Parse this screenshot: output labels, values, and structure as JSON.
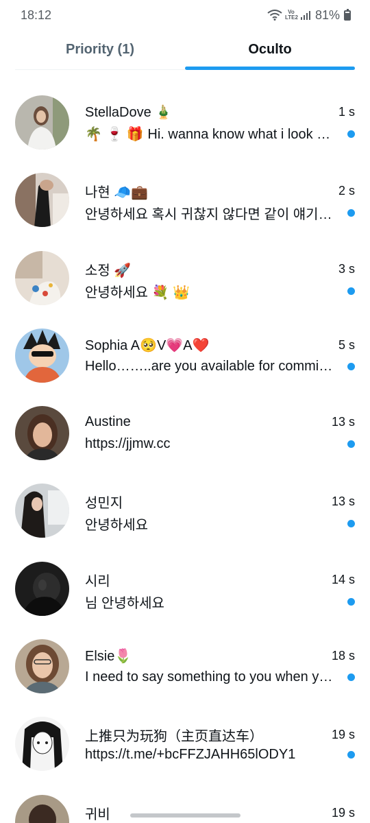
{
  "status_bar": {
    "time": "18:12",
    "network_tag": "Vo LTE2",
    "battery": "81%",
    "battery_level": 0.81
  },
  "tabs": [
    {
      "label": "Priority (1)",
      "active": false
    },
    {
      "label": "Oculto",
      "active": true
    }
  ],
  "accent_color": "#1d9bf0",
  "conversations": [
    {
      "name": "StellaDove 🎍",
      "time": "1 s",
      "preview": "🌴 🍷 🎁 Hi. wanna know what i look like?",
      "unread": true
    },
    {
      "name": "나현 🧢💼",
      "time": "2 s",
      "preview": "안녕하세요 혹시 귀찮지 않다면 같이 얘기해요",
      "unread": true
    },
    {
      "name": "소정 🚀",
      "time": "3 s",
      "preview": "안녕하세요 💐 👑",
      "unread": true
    },
    {
      "name": "Sophia A🥺V💗A❤️",
      "time": "5 s",
      "preview": "Hello……..are you available for commission?",
      "unread": true
    },
    {
      "name": "Austine",
      "time": "13 s",
      "preview": "https://jjmw.cc",
      "unread": true
    },
    {
      "name": "성민지",
      "time": "13 s",
      "preview": "안녕하세요",
      "unread": true
    },
    {
      "name": "시리",
      "time": "14 s",
      "preview": "님 안녕하세요",
      "unread": true
    },
    {
      "name": "Elsie🌷",
      "time": "18 s",
      "preview": "I need to say something to you when you're free",
      "unread": true
    },
    {
      "name": "上推只为玩狗（主页直达车）",
      "time": "19 s",
      "preview": "https://t.me/+bcFFZJAHH65lODY1",
      "unread": true
    },
    {
      "name": "귀비",
      "time": "19 s",
      "preview": "",
      "unread": true
    }
  ]
}
